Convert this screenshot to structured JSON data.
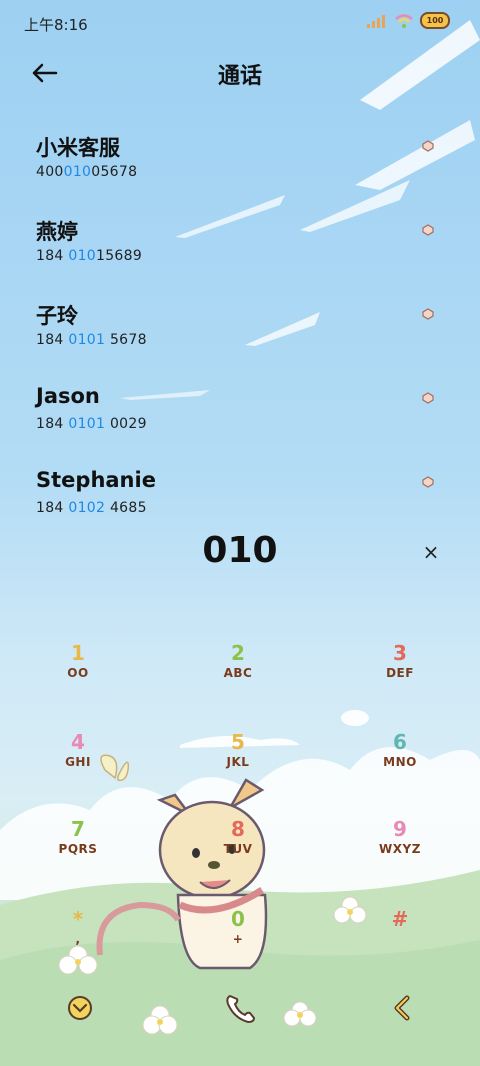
{
  "status": {
    "time": "上午8:16",
    "battery": "100"
  },
  "header": {
    "title": "通话"
  },
  "contacts": [
    {
      "name": "小米客服",
      "num_a": "400",
      "num_hl": "010",
      "num_b": "05678"
    },
    {
      "name": "燕婷",
      "num_a": "184 ",
      "num_hl": "010",
      "num_b": "15689"
    },
    {
      "name": "子玲",
      "num_a": "184 ",
      "num_hl": "0101",
      "num_b": " 5678"
    },
    {
      "name": "Jason",
      "num_a": "184 ",
      "num_hl": "0101",
      "num_b": " 0029"
    },
    {
      "name": "Stephanie",
      "num_a": "184 ",
      "num_hl": "0102",
      "num_b": " 4685"
    }
  ],
  "dial": {
    "typed": "010",
    "clear": "×"
  },
  "keys": [
    {
      "d": "1",
      "l": "OO",
      "color": "#e8b94a"
    },
    {
      "d": "2",
      "l": "ABC",
      "color": "#8cc24a"
    },
    {
      "d": "3",
      "l": "DEF",
      "color": "#e36a5a"
    },
    {
      "d": "4",
      "l": "GHI",
      "color": "#e88ab6"
    },
    {
      "d": "5",
      "l": "JKL",
      "color": "#e8b94a"
    },
    {
      "d": "6",
      "l": "MNO",
      "color": "#5fb8b0"
    },
    {
      "d": "7",
      "l": "PQRS",
      "color": "#8cc24a"
    },
    {
      "d": "8",
      "l": "TUV",
      "color": "#e36a5a"
    },
    {
      "d": "9",
      "l": "WXYZ",
      "color": "#e88ab6"
    },
    {
      "d": "*",
      "l": ",",
      "color": "#e8b94a"
    },
    {
      "d": "0",
      "l": "+",
      "color": "#8cc24a"
    },
    {
      "d": "#",
      "l": "",
      "color": "#e36a5a"
    }
  ],
  "icons": {
    "collapse": "chevron-down-icon",
    "call": "phone-icon",
    "delete": "backspace-icon"
  }
}
